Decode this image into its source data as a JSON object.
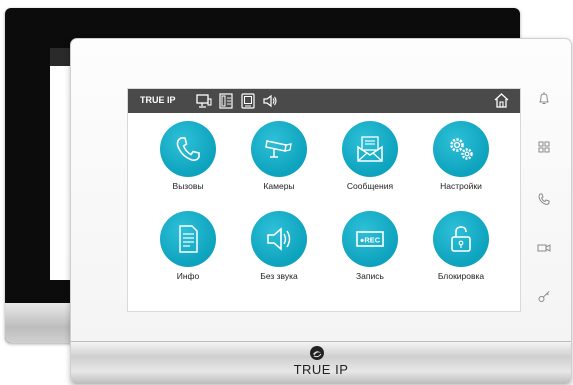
{
  "screen": {
    "title": "TRUE IP",
    "status_icons": [
      "monitor-icon",
      "intercom-icon",
      "door-panel-icon",
      "speaker-icon"
    ],
    "apps": [
      {
        "label": "Вызовы",
        "icon": "phone-icon"
      },
      {
        "label": "Камеры",
        "icon": "camera-icon"
      },
      {
        "label": "Сообщения",
        "icon": "message-icon"
      },
      {
        "label": "Настройки",
        "icon": "gear-icon"
      },
      {
        "label": "Инфо",
        "icon": "document-icon"
      },
      {
        "label": "Без звука",
        "icon": "speaker-icon"
      },
      {
        "label": "Запись",
        "icon": "rec-icon",
        "badge": "●REC"
      },
      {
        "label": "Блокировка",
        "icon": "lock-icon"
      }
    ]
  },
  "brand": {
    "name": "TRUE IP"
  },
  "side_buttons": [
    "bell-icon",
    "grid-icon",
    "phone-icon",
    "camera-icon",
    "key-icon"
  ],
  "colors": {
    "accent": "#0da2bd",
    "topbar": "#4a4a4a"
  }
}
